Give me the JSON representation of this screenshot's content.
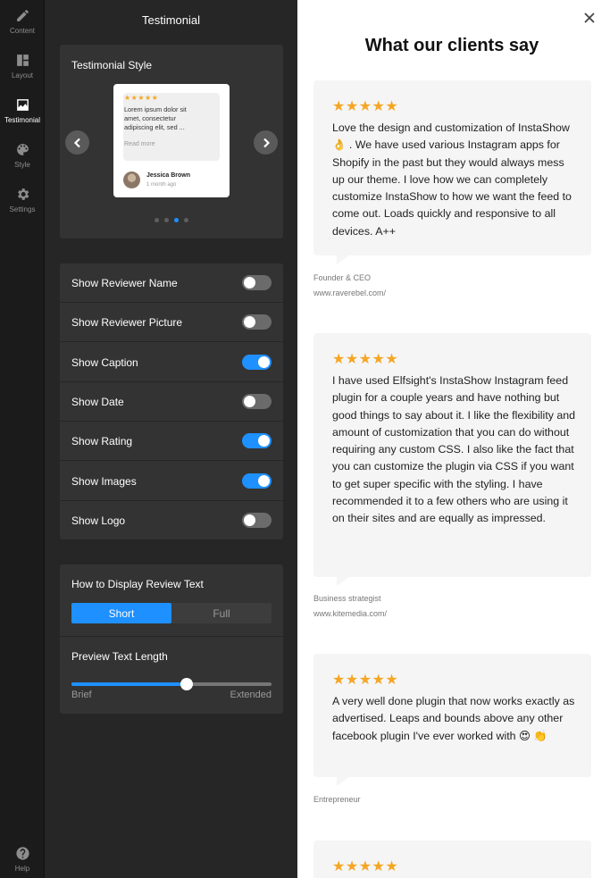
{
  "rail": {
    "items": [
      {
        "label": "Content",
        "icon": "pencil-icon"
      },
      {
        "label": "Layout",
        "icon": "layout-icon"
      },
      {
        "label": "Testimonial",
        "icon": "image-icon"
      },
      {
        "label": "Style",
        "icon": "palette-icon"
      },
      {
        "label": "Settings",
        "icon": "gear-icon"
      }
    ],
    "help": "Help"
  },
  "panel": {
    "title": "Testimonial",
    "style_section": {
      "label": "Testimonial Style",
      "preview": {
        "stars": "★★★★★",
        "text": "Lorem ipsum dolor sit amet, consectetur adipiscing elit, sed ...",
        "more": "Read more",
        "name": "Jessica Brown",
        "date": "1 month ago"
      },
      "pages": 4,
      "active_page": 3
    },
    "toggles": [
      {
        "label": "Show Reviewer Name",
        "on": false
      },
      {
        "label": "Show Reviewer Picture",
        "on": false
      },
      {
        "label": "Show Caption",
        "on": true
      },
      {
        "label": "Show Date",
        "on": false
      },
      {
        "label": "Show Rating",
        "on": true
      },
      {
        "label": "Show Images",
        "on": true
      },
      {
        "label": "Show Logo",
        "on": false
      }
    ],
    "display": {
      "label": "How to Display Review Text",
      "options": [
        "Short",
        "Full"
      ],
      "selected": "Short"
    },
    "length": {
      "label": "Preview Text Length",
      "min_label": "Brief",
      "max_label": "Extended",
      "value_fraction": 0.576
    }
  },
  "preview": {
    "heading": "What our clients say",
    "reviews": [
      {
        "stars": "★★★★★",
        "text": "Love the design and customization of InstaShow 👌 . We have used various Instagram apps for Shopify in the past but they would always mess up our theme. I love how we can completely customize InstaShow to how we want the feed to come out. Loads quickly and responsive to all devices. A++",
        "role": "Founder & CEO",
        "site": "www.raverebel.com/"
      },
      {
        "stars": "★★★★★",
        "text": "I have used Elfsight's InstaShow Instagram feed plugin for a couple years and have nothing but good things to say about it. I like the flexibility and amount of customization that you can do without requiring any custom CSS. I also like the fact that you can customize the plugin via CSS if you want to get super specific with the styling. I have recommended it to a few others who are using it on their sites and are equally as impressed.",
        "role": "Business strategist",
        "site": "www.kitemedia.com/"
      },
      {
        "stars": "★★★★★",
        "text": "A very well done plugin that now works exactly as advertised. Leaps and bounds above any other facebook plugin I've ever worked with 😍 👏",
        "role": "Entrepreneur",
        "site": ""
      },
      {
        "stars": "★★★★★",
        "text": "",
        "role": "",
        "site": ""
      }
    ]
  },
  "colors": {
    "accent": "#1e90ff",
    "star": "#f5a623",
    "panel_bg": "#262626",
    "card_bg": "#333333"
  }
}
